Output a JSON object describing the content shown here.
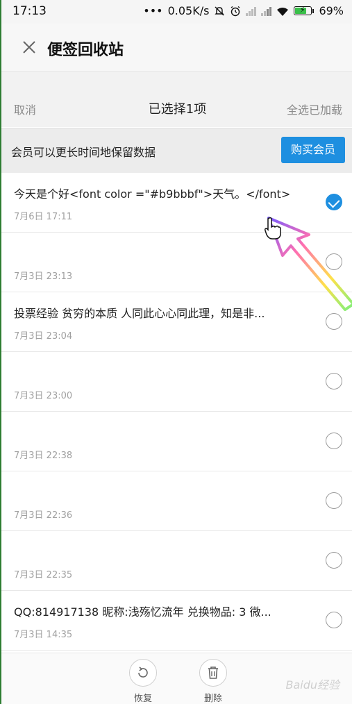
{
  "status_bar": {
    "time": "17:13",
    "dots": "•••",
    "speed": "0.05K/s",
    "battery_percent": "69%",
    "icons": [
      "alarm-off-icon",
      "alarm-clock-icon",
      "signal-icon",
      "signal-icon",
      "wifi-icon",
      "battery-charging-icon"
    ]
  },
  "header": {
    "title": "便签回收站",
    "close_icon": "close-icon"
  },
  "selection_bar": {
    "cancel_label": "取消",
    "selected_label": "已选择1项",
    "select_all_label": "全选已加载"
  },
  "banner": {
    "text": "会员可以更长时间地保留数据",
    "button_label": "购买会员",
    "button_color": "#1e8fe0"
  },
  "notes": [
    {
      "title": "今天是个好<font color =\"#b9bbbf\">天气。</font>",
      "date": "7月6日 17:11",
      "checked": true
    },
    {
      "title": "",
      "date": "7月3日 23:13",
      "checked": false
    },
    {
      "title": "投票经验 贫穷的本质 人同此心心同此理，知是非...",
      "date": "7月3日 23:04",
      "checked": false
    },
    {
      "title": "",
      "date": "7月3日 23:00",
      "checked": false
    },
    {
      "title": "",
      "date": "7月3日 22:38",
      "checked": false
    },
    {
      "title": "",
      "date": "7月3日 22:36",
      "checked": false
    },
    {
      "title": "",
      "date": "7月3日 22:35",
      "checked": false
    },
    {
      "title": "QQ:814917138 昵称:浅殇忆流年 兑换物品: 3 微...",
      "date": "7月3日 14:35",
      "checked": false
    }
  ],
  "bottom_bar": {
    "restore_label": "恢复",
    "delete_label": "删除"
  },
  "watermark": "Baidu经验"
}
